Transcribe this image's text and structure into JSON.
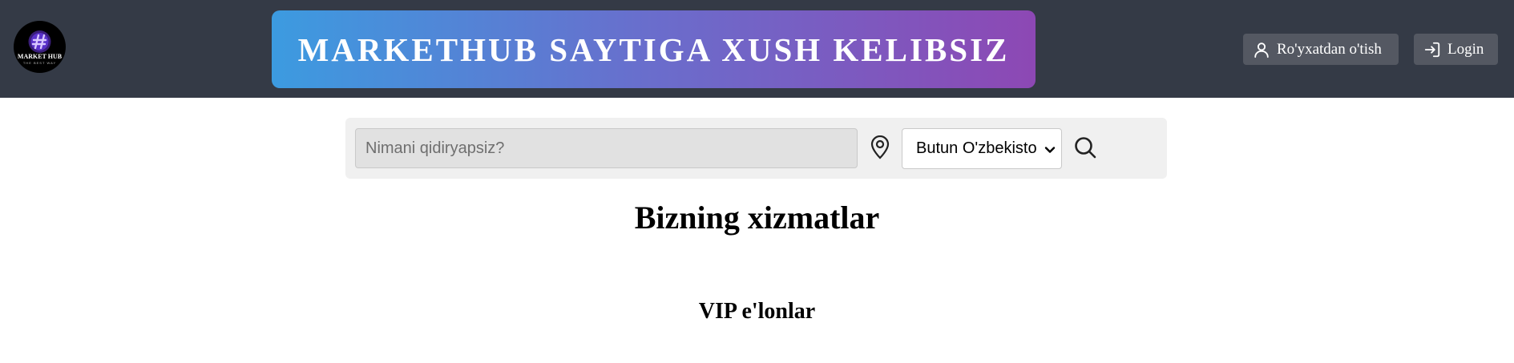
{
  "header": {
    "logo": {
      "text": "MARKET HUB",
      "subtext": "THE BEST WAY",
      "icon": "marketplace-logo-icon"
    },
    "banner_title": "MARKETHUB SAYTIGA XUSH KELIBSIZ",
    "register_label": "Ro'yxatdan o'tish",
    "register_icon": "user-icon",
    "login_label": "Login",
    "login_icon": "sign-in-icon"
  },
  "search": {
    "placeholder": "Nimani qidiryapsiz?",
    "value": "",
    "location_icon": "map-pin-icon",
    "region_selected": "Butun O'zbekiston",
    "search_icon": "search-icon"
  },
  "main": {
    "services_title": "Bizning xizmatlar",
    "vip_title": "VIP e'lonlar"
  },
  "colors": {
    "header_bg": "#343a46",
    "banner_gradient_start": "#3c9be0",
    "banner_gradient_end": "#8d48b4",
    "header_button_bg": "#545862",
    "search_panel_bg": "#f0f0f0"
  }
}
